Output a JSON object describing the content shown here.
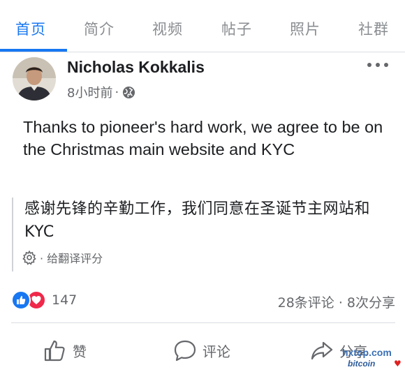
{
  "tabs": [
    {
      "label": "首页",
      "active": true
    },
    {
      "label": "简介"
    },
    {
      "label": "视频"
    },
    {
      "label": "帖子"
    },
    {
      "label": "照片"
    },
    {
      "label": "社群"
    }
  ],
  "post": {
    "author": "Nicholas Kokkalis",
    "time": "8小时前",
    "separator": "·",
    "privacy_icon": "globe-icon",
    "text": "Thanks to pioneer's hard work, we agree to be on the Christmas main website and KYC",
    "translation": "感谢先锋的辛勤工作，我们同意在圣诞节主网站和KYC",
    "rate_translation": "· 给翻译评分"
  },
  "reactions": {
    "icons": [
      "like-icon",
      "love-icon"
    ],
    "count": "147",
    "stats": "28条评论 · 8次分享"
  },
  "actions": {
    "like": "赞",
    "comment": "评论",
    "share": "分享"
  },
  "watermark": {
    "top": "hxtop.com",
    "bottom": "bitcoin"
  },
  "colors": {
    "accent": "#1877f2",
    "love": "#f0284a",
    "muted": "#65676b"
  }
}
